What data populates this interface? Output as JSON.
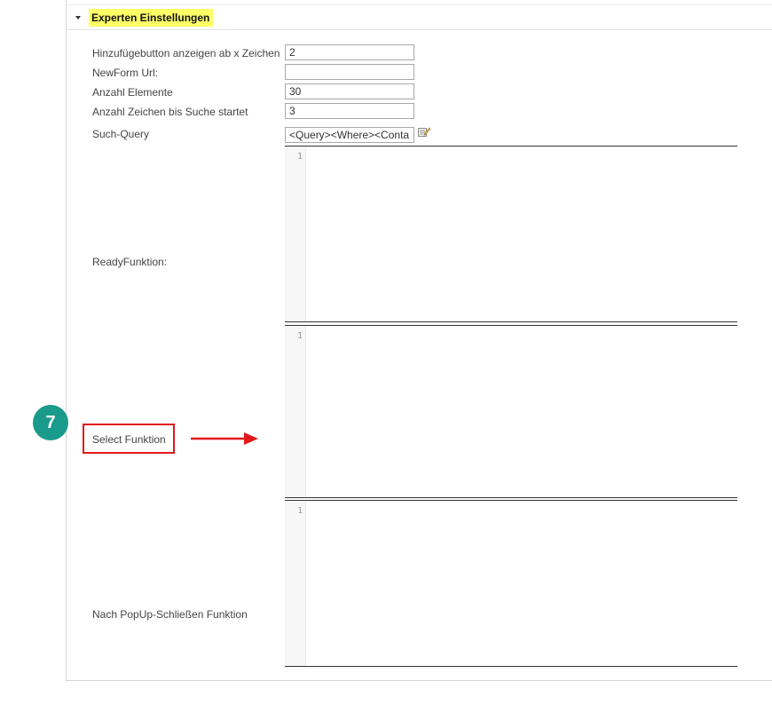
{
  "section": {
    "title": "Experten Einstellungen",
    "collapse_icon": "caret-down-icon"
  },
  "fields": {
    "add_button_threshold": {
      "label": "Hinzufügebutton anzeigen ab x Zeichen",
      "value": "2"
    },
    "newform_url": {
      "label": "NewForm Url:",
      "value": ""
    },
    "element_count": {
      "label": "Anzahl Elemente",
      "value": "30"
    },
    "search_char_count": {
      "label": "Anzahl Zeichen bis Suche startet",
      "value": "3"
    },
    "search_query": {
      "label": "Such-Query",
      "value": "<Query><Where><Conta",
      "edit_icon": "edit-pencil-icon"
    },
    "ready_function": {
      "label": "ReadyFunktion:",
      "line_number": "1"
    },
    "select_function": {
      "label": "Select Funktion",
      "line_number": "1"
    },
    "popup_close_function": {
      "label": "Nach PopUp-Schließen Funktion",
      "line_number": "1"
    }
  },
  "annotation": {
    "step_number": "7",
    "badge_color": "#1a9a8a",
    "highlight_color": "#e01a1a",
    "arrow_icon": "arrow-right-icon"
  },
  "colors": {
    "section_highlight": "#ffff66"
  }
}
